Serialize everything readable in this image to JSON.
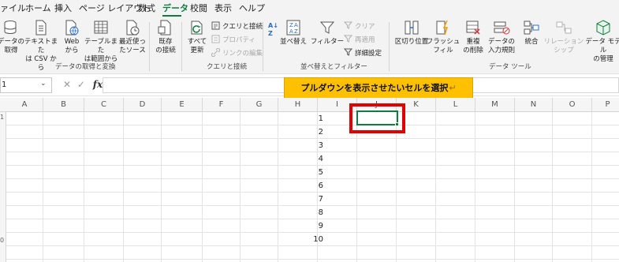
{
  "menu_tabs": [
    "ァイル",
    "ホーム",
    "挿入",
    "ページ レイアウト",
    "数式",
    "データ",
    "校閲",
    "表示",
    "ヘルプ"
  ],
  "active_tab": "データ",
  "ribbon": {
    "get_data": "データの\n取得",
    "from_text_csv": "テキストまた\nは CSV から",
    "from_web": "Web\nから",
    "from_table_range": "テーブルまた\nは範囲から",
    "recent_sources": "最近使っ\nたソース",
    "existing_connections": "既存\nの接続",
    "group_get_transform": "データの取得と変換",
    "refresh_all": "すべて\n更新",
    "queries_connections": "クエリと接続",
    "properties": "プロパティ",
    "edit_links": "リンクの編集",
    "group_queries": "クエリと接続",
    "sort": "並べ替え",
    "filter": "フィルター",
    "clear": "クリア",
    "reapply": "再適用",
    "advanced": "詳細設定",
    "group_sort_filter": "並べ替えとフィルター",
    "text_to_columns": "区切り位置",
    "flash_fill": "フラッシュ\nフィル",
    "remove_duplicates": "重複\nの削除",
    "data_validation": "データの\n入力規則",
    "consolidate": "統合",
    "relationships": "リレーションシップ",
    "data_model": "データ モデル\nの管理",
    "group_data_tools": "データ ツール"
  },
  "formula_bar": {
    "name_box": "1",
    "cancel_symbol": "✕",
    "enter_symbol": "✓",
    "fx_symbol": "fx",
    "value": ""
  },
  "callout": {
    "text": "プルダウンを表示させたいセルを選択",
    "return_mark": "↵"
  },
  "columns": [
    "A",
    "B",
    "C",
    "D",
    "E",
    "F",
    "G",
    "H",
    "I",
    "J",
    "K",
    "L",
    "M",
    "N",
    "O",
    "P"
  ],
  "cell_values": [
    "1",
    "2",
    "3",
    "4",
    "5",
    "6",
    "7",
    "8",
    "9",
    "10"
  ],
  "row_header_fragments": [
    "1",
    "0"
  ],
  "colors": {
    "accent": "#107c41",
    "callout_fill": "#ffc000",
    "highlight": "#e00000"
  }
}
